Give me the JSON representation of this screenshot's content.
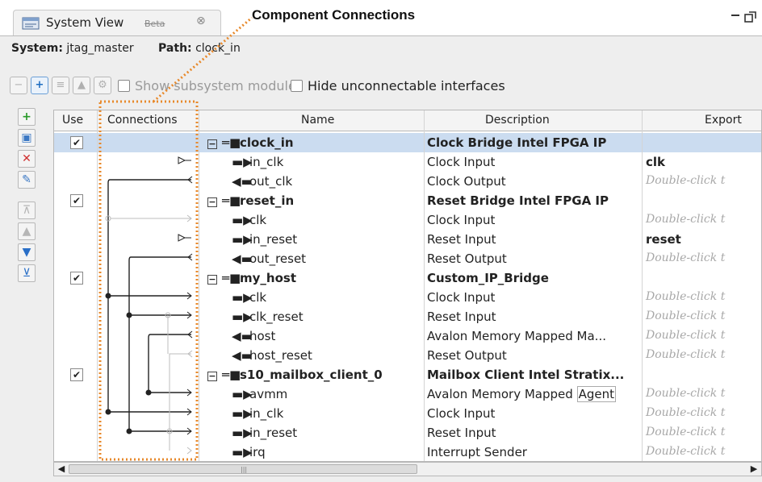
{
  "tab": {
    "title": "System View",
    "beta": "Beta",
    "close": "⊗"
  },
  "callout": {
    "label": "Component Connections"
  },
  "window": {
    "minimize": "_",
    "restore": "□"
  },
  "system": {
    "system_label": "System:",
    "system_value": "jtag_master",
    "path_label": "Path:",
    "path_value": "clock_in"
  },
  "toolbar": {
    "show_subsystem_modules": "Show subsystem modules",
    "hide_unconnectable": "Hide unconnectable interfaces"
  },
  "columns": {
    "use": "Use",
    "connections": "Connections",
    "name": "Name",
    "description": "Description",
    "export": "Export"
  },
  "rows": [
    {
      "type": "component",
      "used": true,
      "name": "clock_in",
      "description": "Clock Bridge Intel FPGA IP",
      "export": "",
      "selected": true
    },
    {
      "type": "interface",
      "dir": "in",
      "name": "in_clk",
      "description": "Clock Input",
      "export": "clk"
    },
    {
      "type": "interface",
      "dir": "out",
      "name": "out_clk",
      "description": "Clock Output",
      "export": "",
      "hint": "Double-click t"
    },
    {
      "type": "component",
      "used": true,
      "name": "reset_in",
      "description": "Reset Bridge Intel FPGA IP",
      "export": ""
    },
    {
      "type": "interface",
      "dir": "in",
      "name": "clk",
      "description": "Clock Input",
      "export": "",
      "hint": "Double-click t"
    },
    {
      "type": "interface",
      "dir": "in",
      "name": "in_reset",
      "description": "Reset Input",
      "export": "reset"
    },
    {
      "type": "interface",
      "dir": "out",
      "name": "out_reset",
      "description": "Reset Output",
      "export": "",
      "hint": "Double-click t"
    },
    {
      "type": "component",
      "used": true,
      "name": "my_host",
      "description": "Custom_IP_Bridge",
      "export": ""
    },
    {
      "type": "interface",
      "dir": "in",
      "name": "clk",
      "description": "Clock Input",
      "export": "",
      "hint": "Double-click t"
    },
    {
      "type": "interface",
      "dir": "in",
      "name": "clk_reset",
      "description": "Reset Input",
      "export": "",
      "hint": "Double-click t"
    },
    {
      "type": "interface",
      "dir": "out",
      "name": "host",
      "description": "Avalon Memory Mapped Ma...",
      "export": "",
      "hint": "Double-click t"
    },
    {
      "type": "interface",
      "dir": "out",
      "name": "host_reset",
      "description": "Reset Output",
      "export": "",
      "hint": "Double-click t"
    },
    {
      "type": "component",
      "used": true,
      "name": "s10_mailbox_client_0",
      "description": "Mailbox Client Intel Stratix...",
      "export": ""
    },
    {
      "type": "interface",
      "dir": "in",
      "name": "avmm",
      "description": "Avalon Memory Mapped",
      "description_tail": "Agent",
      "export": "",
      "hint": "Double-click t"
    },
    {
      "type": "interface",
      "dir": "in",
      "name": "in_clk",
      "description": "Clock Input",
      "export": "",
      "hint": "Double-click t"
    },
    {
      "type": "interface",
      "dir": "in",
      "name": "in_reset",
      "description": "Reset Input",
      "export": "",
      "hint": "Double-click t"
    },
    {
      "type": "interface",
      "dir": "in",
      "name": "irq",
      "description": "Interrupt Sender",
      "export": "",
      "hint": "Double-click t"
    }
  ],
  "colors": {
    "selection": "#cbdcf0",
    "callout": "#e8892b",
    "hint": "#a8a8a8"
  }
}
